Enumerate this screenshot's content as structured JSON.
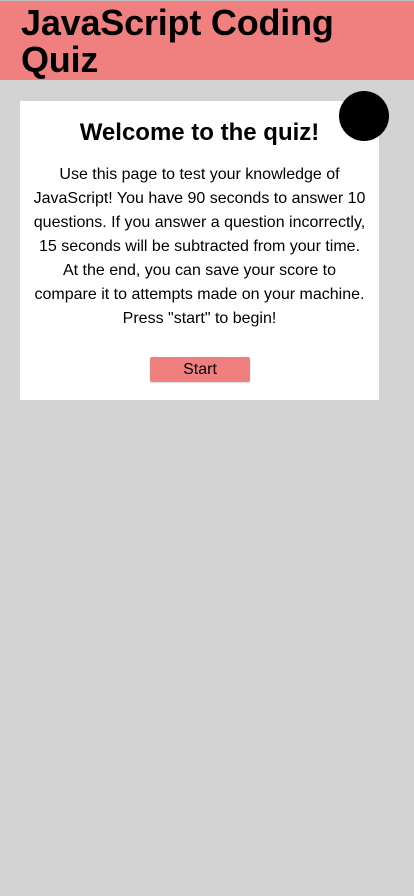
{
  "header": {
    "title": "JavaScript Coding Quiz"
  },
  "intro": {
    "title": "Welcome to the quiz!",
    "description": "Use this page to test your knowledge of JavaScript! You have 90 seconds to answer 10 questions. If you answer a question incorrectly, 15 seconds will be subtracted from your time. At the end, you can save your score to compare it to attempts made on your machine. Press \"start\" to begin!",
    "start_label": "Start"
  },
  "colors": {
    "accent": "#f08080",
    "page_background": "#d3d3d3",
    "card_background": "#ffffff",
    "timer_indicator": "#000000"
  }
}
